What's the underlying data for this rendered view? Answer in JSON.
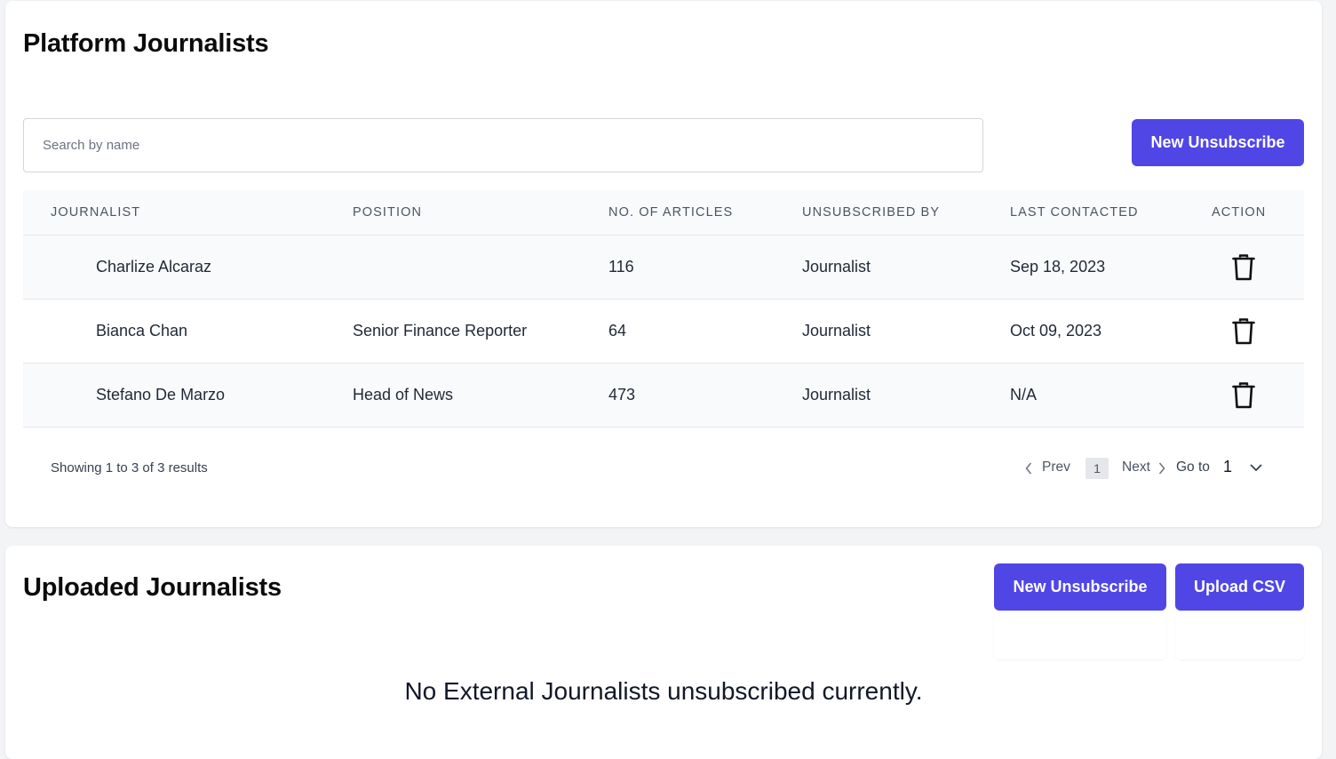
{
  "platform": {
    "title": "Platform Journalists",
    "search_placeholder": "Search by name",
    "new_unsubscribe_label": "New Unsubscribe",
    "columns": [
      "JOURNALIST",
      "POSITION",
      "NO. OF ARTICLES",
      "UNSUBSCRIBED BY",
      "LAST CONTACTED",
      "ACTION"
    ],
    "rows": [
      {
        "name": "Charlize Alcaraz",
        "position": "",
        "articles": "116",
        "unsubscribed_by": "Journalist",
        "last_contacted": "Sep 18, 2023",
        "action_icon": "trash-icon"
      },
      {
        "name": "Bianca Chan",
        "position": "Senior Finance Reporter",
        "articles": "64",
        "unsubscribed_by": "Journalist",
        "last_contacted": "Oct 09, 2023",
        "action_icon": "trash-icon"
      },
      {
        "name": "Stefano De Marzo",
        "position": "Head of News",
        "articles": "473",
        "unsubscribed_by": "Journalist",
        "last_contacted": "N/A",
        "action_icon": "trash-icon"
      }
    ],
    "pagination": {
      "showing_text": "Showing 1 to 3 of 3 results",
      "prev_label": "Prev",
      "current_page": "1",
      "next_label": "Next",
      "goto_label": "Go to",
      "goto_value": "1"
    }
  },
  "uploaded": {
    "title": "Uploaded Journalists",
    "new_unsubscribe_label": "New Unsubscribe",
    "upload_csv_label": "Upload CSV",
    "empty_message": "No External Journalists unsubscribed currently."
  },
  "colors": {
    "accent": "#4f46e5",
    "background": "#f3f4f6",
    "row_alt": "#f9fafb"
  }
}
